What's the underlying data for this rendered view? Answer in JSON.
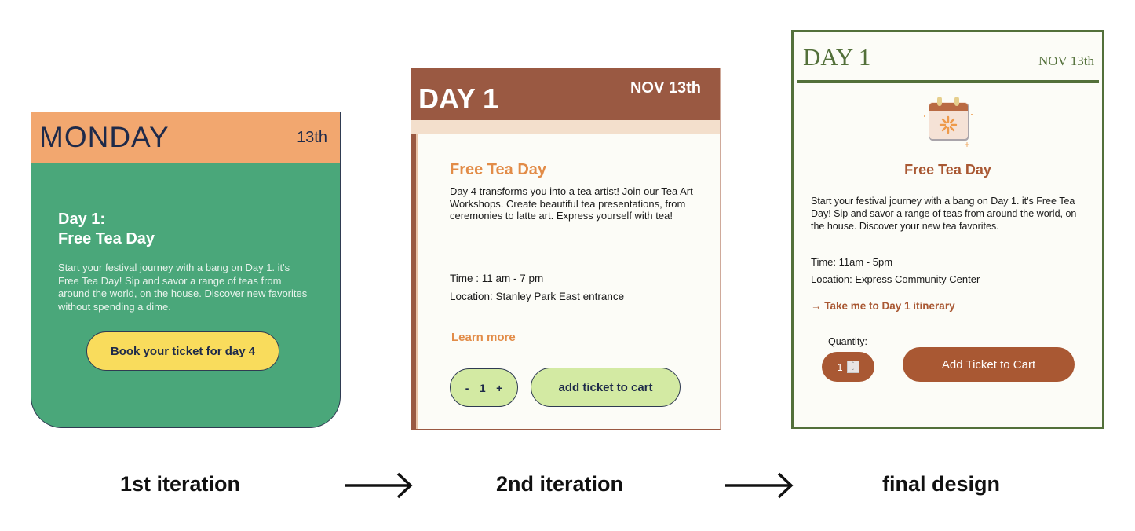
{
  "iterations": [
    {
      "caption": "1st iteration",
      "header_day": "MONDAY",
      "header_date": "13th",
      "title_line1": "Day 1:",
      "title_line2": "Free Tea Day",
      "description": "Start your festival journey with a bang on Day 1. it's Free Tea Day! Sip and savor a range of teas from around the world, on the house. Discover new favorites without spending a dime.",
      "button_label": "Book your ticket for day 4",
      "colors": {
        "header": "#f2a76f",
        "body": "#4aa77a",
        "button": "#f9dc5c"
      }
    },
    {
      "caption": "2nd iteration",
      "header_day": "DAY 1",
      "header_date": "NOV 13th",
      "title": "Free Tea Day",
      "description": "Day 4 transforms you into a tea artist! Join our Tea Art Workshops. Create beautiful tea presentations, from ceremonies to latte art. Express yourself with tea!",
      "time": "Time : 11 am - 7 pm",
      "location": "Location: Stanley Park East entrance",
      "link_label": "Learn more",
      "qty_minus": "-",
      "qty_value": "1",
      "qty_plus": "+",
      "button_label": "add ticket to cart",
      "colors": {
        "header": "#9a5942",
        "accent": "#e28c48",
        "button": "#d3eaa3"
      }
    },
    {
      "caption": "final design",
      "header_day": "DAY 1",
      "header_date": "NOV 13th",
      "icon": "calendar-icon",
      "title": "Free Tea Day",
      "description": "Start your festival journey with a bang on Day 1. it's Free Tea Day! Sip and savor a range of teas from around the world, on the house. Discover your new tea favorites.",
      "time": "Time: 11am - 5pm",
      "location": "Location: Express Community Center",
      "link_label": "→ Take me to Day 1 itinerary",
      "quantity_label": "Quantity:",
      "qty_value": "1",
      "button_label": "Add Ticket to Cart",
      "colors": {
        "frame": "#53703a",
        "accent": "#a95833"
      }
    }
  ],
  "arrows": [
    "arrow-right-icon",
    "arrow-right-icon"
  ]
}
